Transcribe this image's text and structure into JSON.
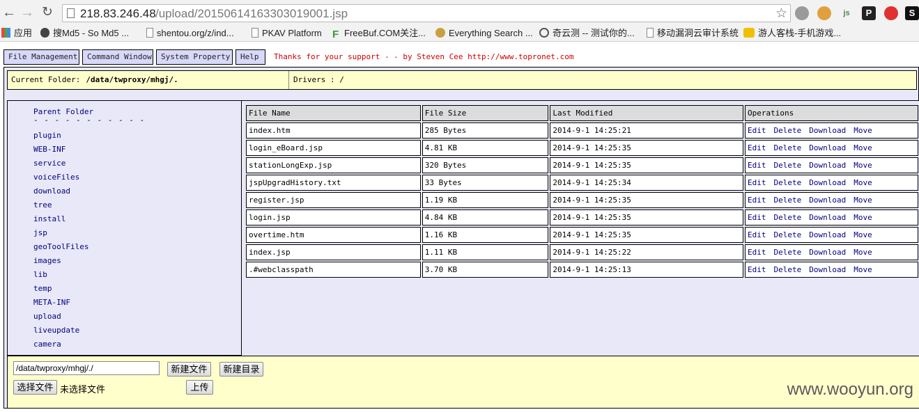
{
  "browser": {
    "url_host": "218.83.246.48",
    "url_path": "/upload/20150614163303019001.jsp",
    "ext_labels": [
      "",
      "",
      "js",
      "P",
      "",
      "S"
    ]
  },
  "bookmarks": [
    {
      "label": "应用",
      "icon": "apps-icon"
    },
    {
      "label": "搜Md5 - So Md5 ...",
      "icon": "md5-icon"
    },
    {
      "label": "shentou.org/z/ind...",
      "icon": "page-icon"
    },
    {
      "label": "PKAV Platform",
      "icon": "page-icon"
    },
    {
      "label": "FreeBuf.COM关注...",
      "icon": "freebuf-icon"
    },
    {
      "label": "Everything Search ...",
      "icon": "search-icon"
    },
    {
      "label": "奇云测 -- 测试你的...",
      "icon": "qiyun-icon"
    },
    {
      "label": "移动漏洞云审计系统",
      "icon": "page-icon"
    },
    {
      "label": "游人客栈-手机游戏...",
      "icon": "game-icon"
    }
  ],
  "menu": {
    "file_management": "File Management",
    "command_window": "Command Window",
    "system_property": "System Property",
    "help": "Help",
    "thanks": "Thanks for your support - - by Steven Cee http://www.topronet.com"
  },
  "folder_bar": {
    "label": "Current Folder:",
    "path": "/data/twproxy/mhgj/.",
    "drivers": "Drivers : /"
  },
  "tree": {
    "parent": "Parent Folder",
    "separator": "- - - - - - - - - - -",
    "folders": [
      "plugin",
      "WEB-INF",
      "service",
      "voiceFiles",
      "download",
      "tree",
      "install",
      "jsp",
      "geoToolFiles",
      "images",
      "lib",
      "temp",
      "META-INF",
      "upload",
      "liveupdate",
      "camera"
    ]
  },
  "table": {
    "headers": [
      "File Name",
      "File Size",
      "Last Modified",
      "Operations"
    ],
    "ops": [
      "Edit",
      "Delete",
      "Download",
      "Move"
    ],
    "rows": [
      {
        "name": "index.htm",
        "size": "285 Bytes",
        "modified": "2014-9-1 14:25:21"
      },
      {
        "name": "login_eBoard.jsp",
        "size": "4.81 KB",
        "modified": "2014-9-1 14:25:35"
      },
      {
        "name": "stationLongExp.jsp",
        "size": "320 Bytes",
        "modified": "2014-9-1 14:25:35"
      },
      {
        "name": "jspUpgradHistory.txt",
        "size": "33 Bytes",
        "modified": "2014-9-1 14:25:34"
      },
      {
        "name": "register.jsp",
        "size": "1.19 KB",
        "modified": "2014-9-1 14:25:35"
      },
      {
        "name": "login.jsp",
        "size": "4.84 KB",
        "modified": "2014-9-1 14:25:35"
      },
      {
        "name": "overtime.htm",
        "size": "1.16 KB",
        "modified": "2014-9-1 14:25:35"
      },
      {
        "name": "index.jsp",
        "size": "1.11 KB",
        "modified": "2014-9-1 14:25:22"
      },
      {
        "name": ".#webclasspath",
        "size": "3.70 KB",
        "modified": "2014-9-1 14:25:13"
      }
    ]
  },
  "bottom": {
    "path_value": "/data/twproxy/mhgj/./",
    "new_file": "新建文件",
    "new_dir": "新建目录",
    "choose_file": "选择文件",
    "no_file": "未选择文件",
    "upload": "上传"
  },
  "watermark": "www.wooyun.org"
}
